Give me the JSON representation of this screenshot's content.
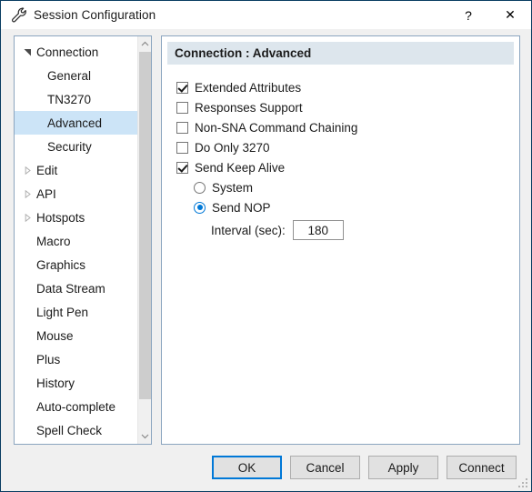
{
  "window": {
    "title": "Session Configuration",
    "icon": "wrench-icon",
    "help_label": "?",
    "close_label": "✕"
  },
  "sidebar": {
    "items": [
      {
        "label": "Connection",
        "level": 0,
        "state": "expanded",
        "selected": false
      },
      {
        "label": "General",
        "level": 1,
        "state": "leaf",
        "selected": false
      },
      {
        "label": "TN3270",
        "level": 1,
        "state": "leaf",
        "selected": false
      },
      {
        "label": "Advanced",
        "level": 1,
        "state": "leaf",
        "selected": true
      },
      {
        "label": "Security",
        "level": 1,
        "state": "leaf",
        "selected": false
      },
      {
        "label": "Edit",
        "level": 0,
        "state": "collapsed",
        "selected": false
      },
      {
        "label": "API",
        "level": 0,
        "state": "collapsed",
        "selected": false
      },
      {
        "label": "Hotspots",
        "level": 0,
        "state": "collapsed",
        "selected": false
      },
      {
        "label": "Macro",
        "level": 0,
        "state": "leaf",
        "selected": false
      },
      {
        "label": "Graphics",
        "level": 0,
        "state": "leaf",
        "selected": false
      },
      {
        "label": "Data Stream",
        "level": 0,
        "state": "leaf",
        "selected": false
      },
      {
        "label": "Light Pen",
        "level": 0,
        "state": "leaf",
        "selected": false
      },
      {
        "label": "Mouse",
        "level": 0,
        "state": "leaf",
        "selected": false
      },
      {
        "label": "Plus",
        "level": 0,
        "state": "leaf",
        "selected": false
      },
      {
        "label": "History",
        "level": 0,
        "state": "leaf",
        "selected": false
      },
      {
        "label": "Auto-complete",
        "level": 0,
        "state": "leaf",
        "selected": false
      },
      {
        "label": "Spell Check",
        "level": 0,
        "state": "leaf",
        "selected": false
      }
    ]
  },
  "panel": {
    "header": "Connection : Advanced",
    "checkboxes": [
      {
        "label": "Extended Attributes",
        "checked": true
      },
      {
        "label": "Responses Support",
        "checked": false
      },
      {
        "label": "Non-SNA Command Chaining",
        "checked": false
      },
      {
        "label": "Do Only 3270",
        "checked": false
      },
      {
        "label": "Send Keep Alive",
        "checked": true
      }
    ],
    "radios": [
      {
        "label": "System",
        "selected": false
      },
      {
        "label": "Send NOP",
        "selected": true
      }
    ],
    "interval": {
      "label": "Interval (sec):",
      "value": "180"
    }
  },
  "footer": {
    "buttons": [
      {
        "label": "OK",
        "default": true
      },
      {
        "label": "Cancel",
        "default": false
      },
      {
        "label": "Apply",
        "default": false
      },
      {
        "label": "Connect",
        "default": false
      }
    ]
  },
  "colors": {
    "accent": "#0078d7",
    "selection": "#cce4f7",
    "header_band": "#dde6ed",
    "panel_border": "#8ba5bf",
    "dialog_border": "#0a3d62",
    "button_face": "#e1e1e1"
  }
}
